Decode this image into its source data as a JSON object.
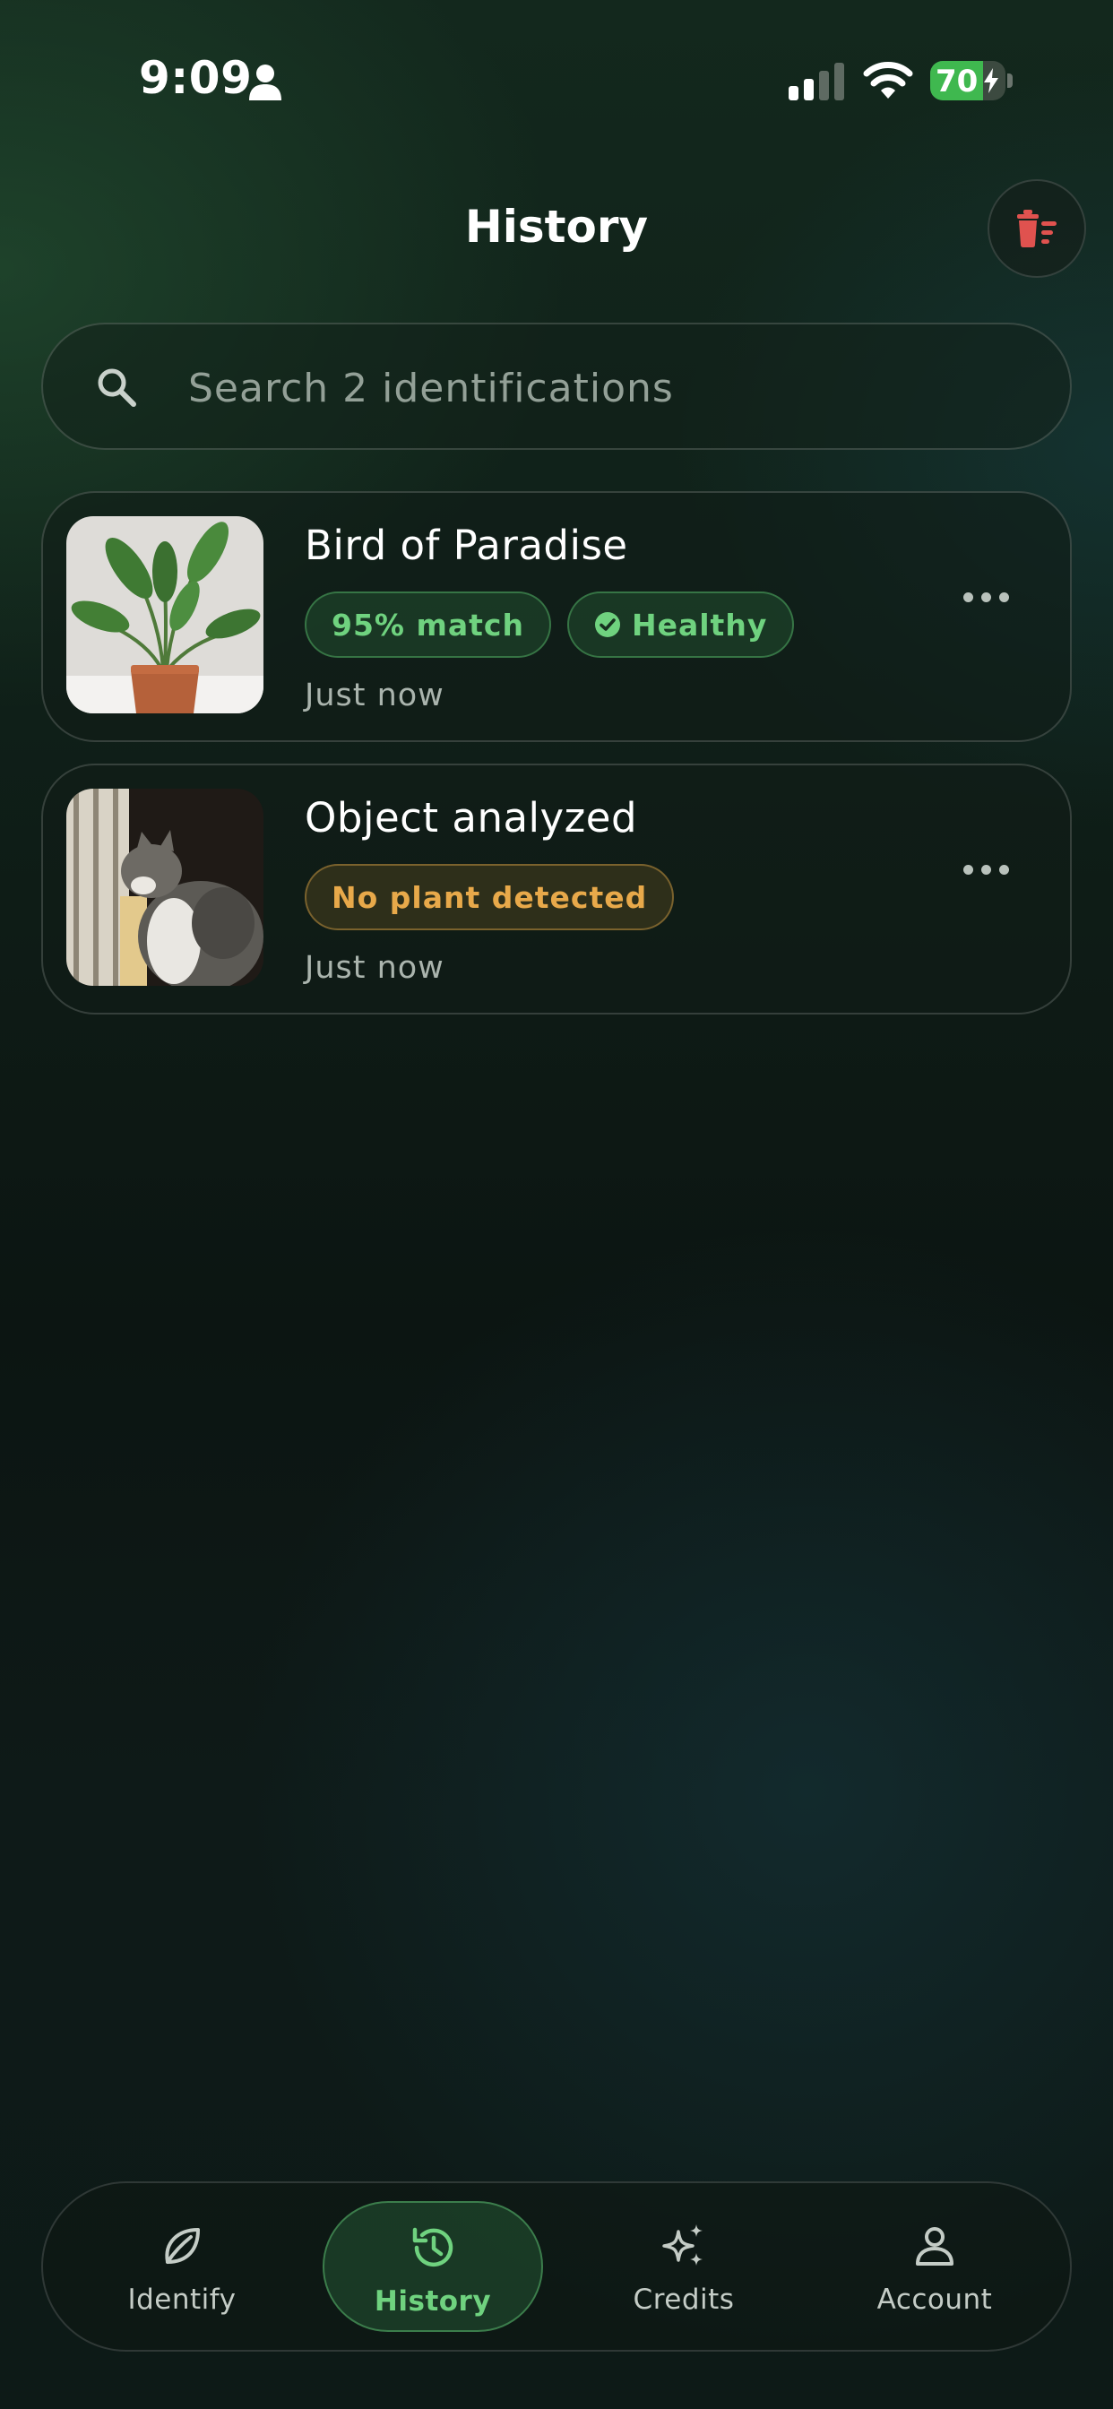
{
  "status_bar": {
    "time": "9:09",
    "battery_level": "70",
    "icons": [
      "person-icon",
      "cellular-signal-icon",
      "wifi-icon",
      "battery-charging-icon"
    ]
  },
  "header": {
    "title": "History",
    "clear_icon": "trash-list-icon"
  },
  "search": {
    "placeholder": "Search 2 identifications",
    "value": "",
    "icon": "search-icon"
  },
  "history_items": [
    {
      "title": "Bird of Paradise",
      "match_chip": "95% match",
      "health_chip": "Healthy",
      "time": "Just now",
      "thumbnail": "potted-plant-photo"
    },
    {
      "title": "Object analyzed",
      "status_chip": "No plant detected",
      "time": "Just now",
      "thumbnail": "cat-photo"
    }
  ],
  "tab_bar": {
    "active": "History",
    "tabs": [
      {
        "label": "Identify",
        "icon": "leaf-icon"
      },
      {
        "label": "History",
        "icon": "history-icon"
      },
      {
        "label": "Credits",
        "icon": "sparkles-icon"
      },
      {
        "label": "Account",
        "icon": "person-icon"
      }
    ]
  },
  "colors": {
    "accent_green": "#6fd27f",
    "warning_orange": "#e8a94a",
    "danger_red": "#e0524f",
    "background": "#0f1f18"
  }
}
